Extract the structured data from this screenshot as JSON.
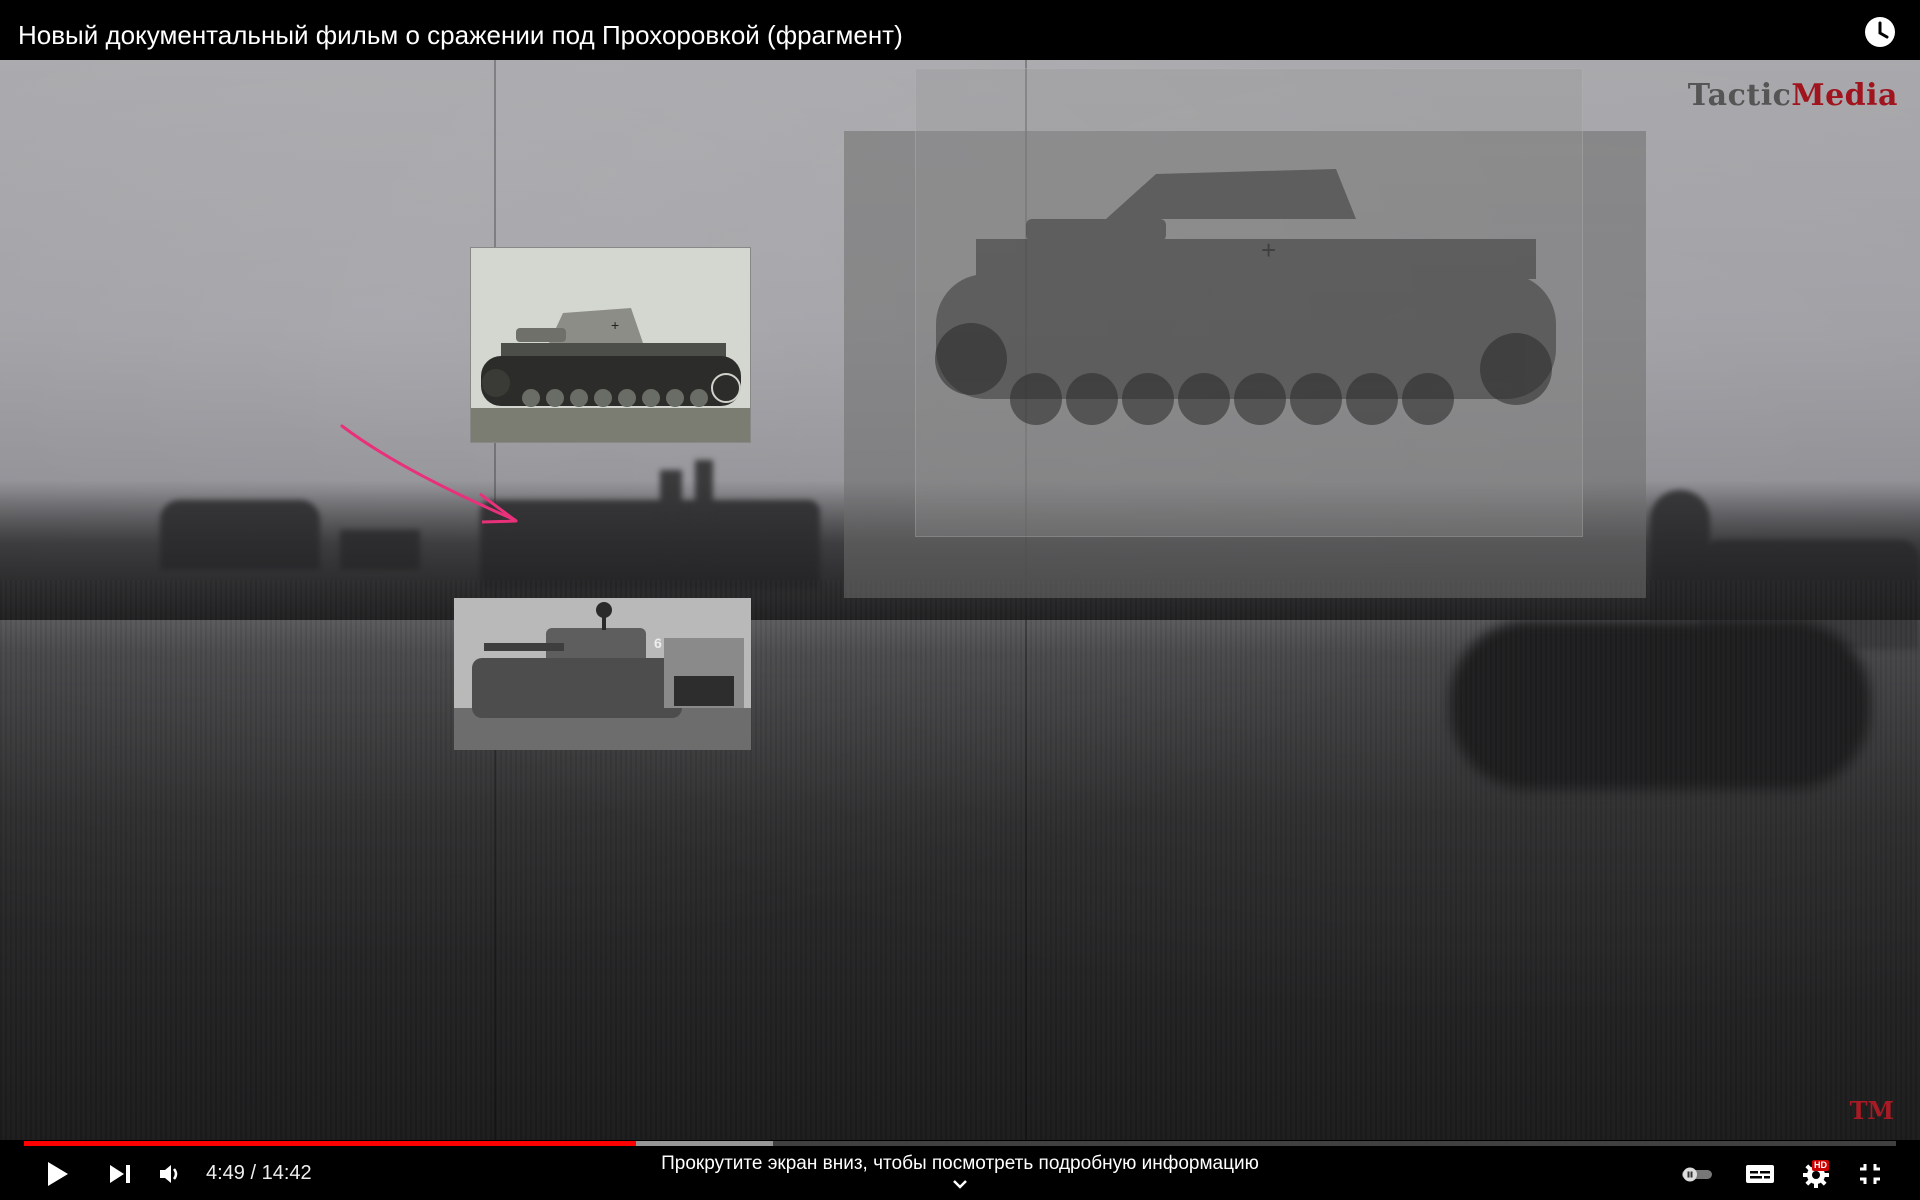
{
  "header": {
    "title": "Новый документальный фильм о сражении под Прохоровкой (фрагмент)",
    "watch_later_icon": "clock-icon"
  },
  "video": {
    "logo_part1": "Tactic",
    "logo_part2": "Media",
    "corner_mark": "TM",
    "arrow_color": "#e8317a"
  },
  "player": {
    "current_time": "4:49",
    "separator": " / ",
    "duration": "14:42",
    "played_fraction": 0.327,
    "buffered_fraction": 0.4,
    "scroll_hint": "Прокрутите экран вниз, чтобы посмотреть подробную информацию",
    "quality_badge": "HD",
    "accent_color": "#ff0000",
    "icons": {
      "play": "play-icon",
      "next": "next-icon",
      "volume": "volume-icon",
      "autoplay": "autoplay-toggle-icon",
      "subtitles": "subtitles-icon",
      "settings": "gear-icon",
      "exit_fullscreen": "exit-fullscreen-icon"
    }
  }
}
